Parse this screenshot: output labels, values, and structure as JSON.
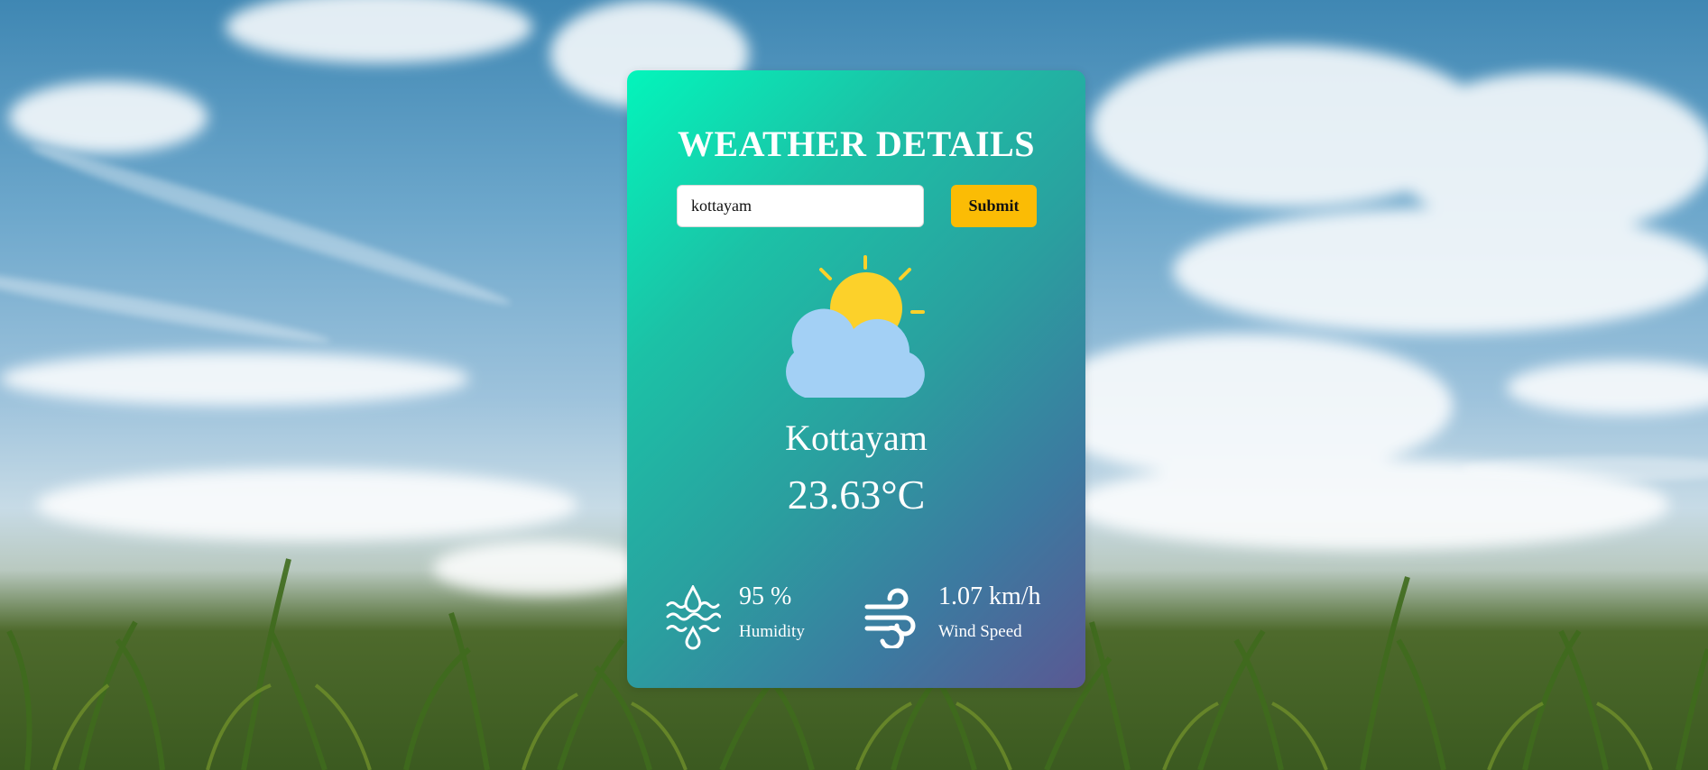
{
  "header": {
    "title": "WEATHER DETAILS"
  },
  "search": {
    "value": "kottayam",
    "submit_label": "Submit"
  },
  "weather": {
    "icon": "partly-cloudy-icon",
    "city": "Kottayam",
    "temperature": "23.63°C"
  },
  "stats": {
    "humidity": {
      "value": "95 %",
      "label": "Humidity",
      "icon": "humidity-icon"
    },
    "wind": {
      "value": "1.07 km/h",
      "label": "Wind Speed",
      "icon": "wind-icon"
    }
  },
  "colors": {
    "card_gradient_start": "#03f5bb",
    "card_gradient_end": "#5a5893",
    "button": "#fbbc05",
    "sun": "#fcd12a",
    "cloud": "#a3d0f5",
    "text": "#ffffff"
  }
}
